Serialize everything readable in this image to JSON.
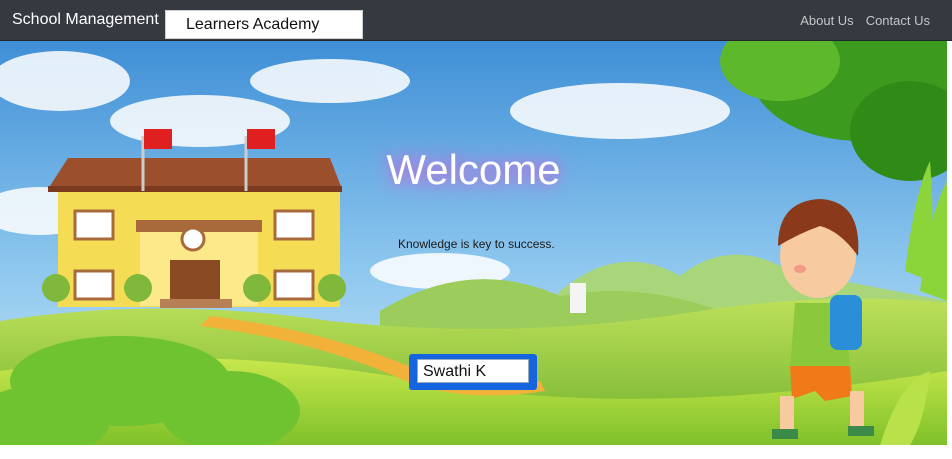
{
  "navbar": {
    "brand": "School Management",
    "academy_name": "Learners Academy",
    "links": [
      "About Us",
      "Contact Us"
    ]
  },
  "hero": {
    "heading": "Welcome",
    "tagline": "Knowledge is key to success.",
    "user_name": "Swathi K"
  },
  "colors": {
    "navbar_bg": "#343a40",
    "name_box_border": "#1565e0",
    "sky": "#6cb4e6",
    "grass": "#8cc83c"
  }
}
